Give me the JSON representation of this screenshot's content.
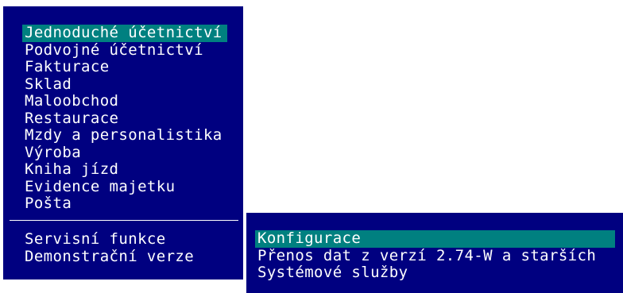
{
  "main_menu": {
    "items": [
      {
        "label": "Jednoduché účetnictví",
        "selected": true
      },
      {
        "label": "Podvojné účetnictví",
        "selected": false
      },
      {
        "label": "Fakturace",
        "selected": false
      },
      {
        "label": "Sklad",
        "selected": false
      },
      {
        "label": "Maloobchod",
        "selected": false
      },
      {
        "label": "Restaurace",
        "selected": false
      },
      {
        "label": "Mzdy a personalistika",
        "selected": false
      },
      {
        "label": "Výroba",
        "selected": false
      },
      {
        "label": "Kniha jízd",
        "selected": false
      },
      {
        "label": "Evidence majetku",
        "selected": false
      },
      {
        "label": "Pošta",
        "selected": false
      }
    ],
    "bottom_items": [
      {
        "label": "Servisní funkce",
        "selected": false
      },
      {
        "label": "Demonstrační verze",
        "selected": false
      }
    ]
  },
  "sub_menu": {
    "items": [
      {
        "label": "Konfigurace",
        "selected": true
      },
      {
        "label": "Přenos dat z verzí 2.74-W a starších",
        "selected": false
      },
      {
        "label": "Systémové služby",
        "selected": false
      }
    ]
  },
  "colors": {
    "menu_background": "#000080",
    "selection_highlight": "#008080",
    "text": "#ffffff",
    "screen_background": "#ffffff"
  }
}
